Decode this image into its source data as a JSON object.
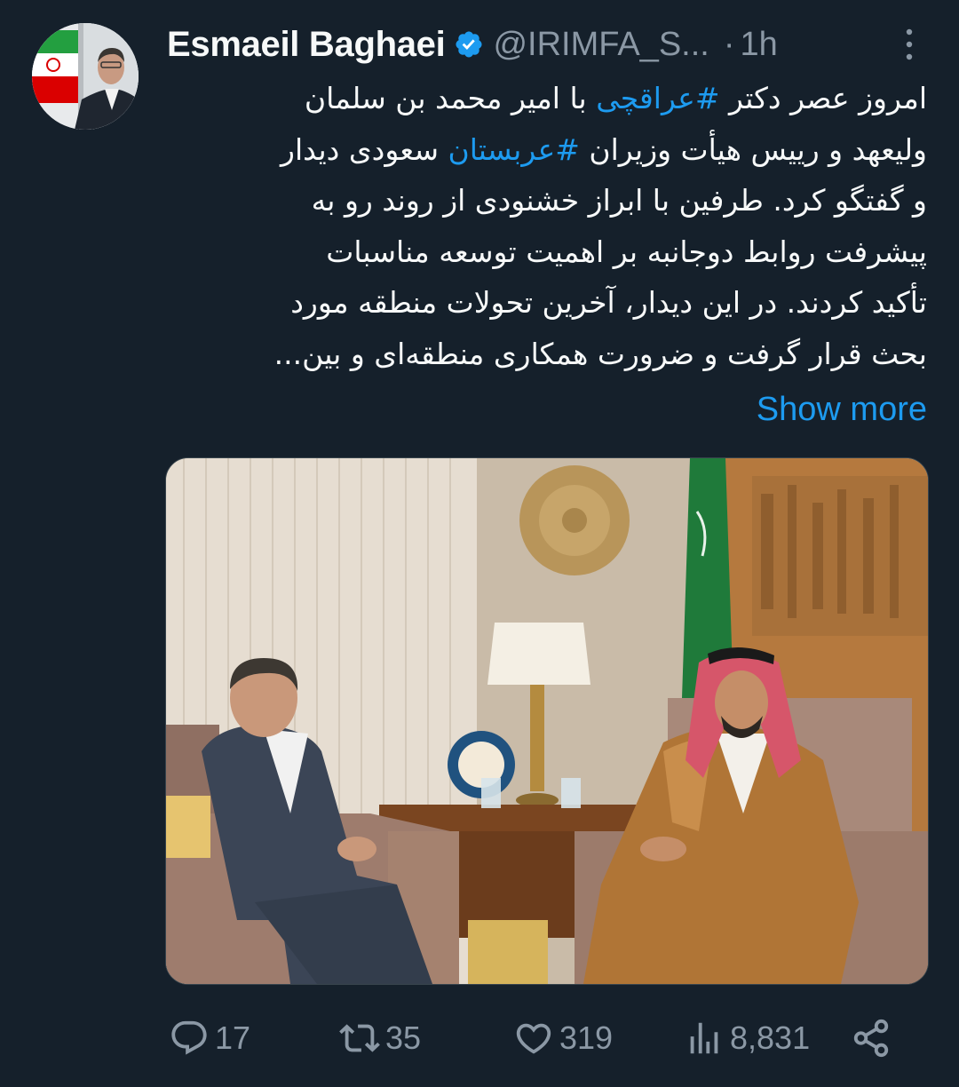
{
  "tweet": {
    "author": {
      "display_name": "Esmaeil Baghaei",
      "handle": "@IRIMFA_S...",
      "verified": true,
      "time": "1h"
    },
    "body": {
      "line1": {
        "before": "امروز عصر دکتر ",
        "hashtag": "#عراقچی",
        "after": " با امیر محمد بن سلمان"
      },
      "line2": {
        "before": "ولیعهد و رییس هیأت وزیران ",
        "hashtag": "#عربستان",
        "after": " سعودی دیدار"
      },
      "line3": "و گفتگو کرد. طرفین با ابراز خشنودی از روند رو به",
      "line4": "پیشرفت روابط دوجانبه بر اهمیت توسعه مناسبات",
      "line5": "تأکید کردند. در این دیدار، آخرین تحولات منطقه مورد",
      "line6": "بحث قرار گرفت و ضرورت همکاری منطقه‌ای و بین..."
    },
    "show_more_label": "Show more",
    "stats": {
      "replies": "17",
      "retweets": "35",
      "likes": "319",
      "views": "8,831"
    }
  },
  "icons": {
    "verified": "verified-badge-icon",
    "more": "more-vertical-icon",
    "reply": "reply-icon",
    "retweet": "retweet-icon",
    "like": "heart-icon",
    "views": "views-chart-icon",
    "share": "share-icon"
  },
  "colors": {
    "background": "#15202b",
    "text": "#f7f9f9",
    "muted": "#8b98a5",
    "accent": "#1d9bf0"
  }
}
